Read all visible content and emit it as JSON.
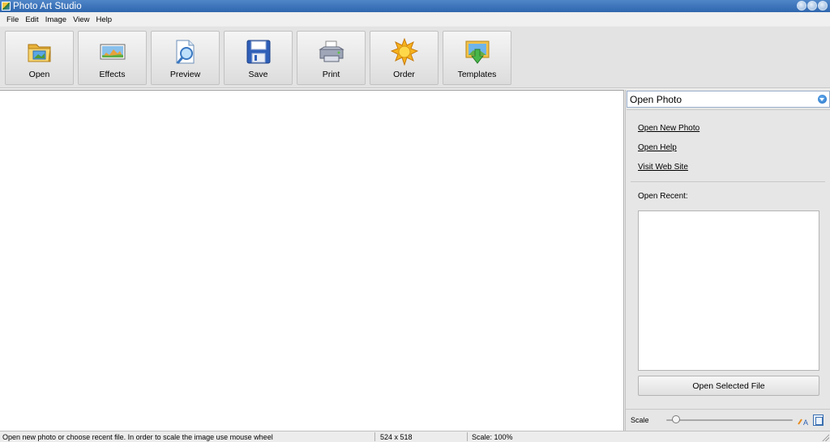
{
  "window": {
    "title": "Photo Art Studio"
  },
  "menu": [
    "File",
    "Edit",
    "Image",
    "View",
    "Help"
  ],
  "toolbar": {
    "buttons": [
      {
        "label": "Open",
        "icon": "folder-icon"
      },
      {
        "label": "Effects",
        "icon": "effects-icon"
      },
      {
        "label": "Preview",
        "icon": "preview-icon"
      },
      {
        "label": "Save",
        "icon": "floppy-disk-icon"
      },
      {
        "label": "Print",
        "icon": "printer-icon"
      },
      {
        "label": "Order",
        "icon": "sun-icon"
      },
      {
        "label": "Templates",
        "icon": "templates-icon"
      }
    ]
  },
  "panel": {
    "selected": "Open Photo",
    "links": [
      "Open New Photo",
      "Open Help",
      "Visit Web Site"
    ],
    "recent_label": "Open Recent:",
    "open_button": "Open Selected File",
    "scale_label": "Scale"
  },
  "status": {
    "message": "Open new photo or choose recent file. In order to scale the image use mouse wheel",
    "size": "524 x 518",
    "scale": "Scale: 100%"
  }
}
